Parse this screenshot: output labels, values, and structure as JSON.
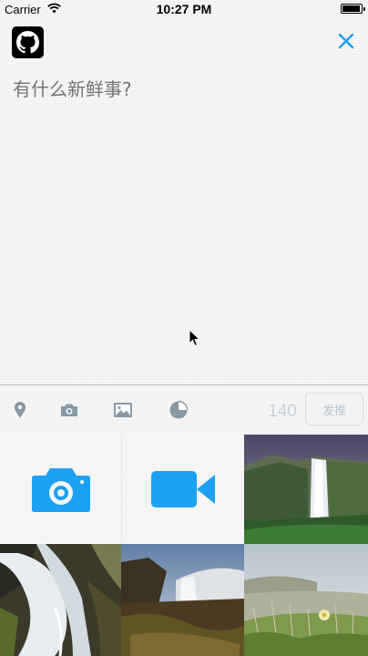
{
  "status_bar": {
    "carrier": "Carrier",
    "time": "10:27 PM",
    "battery_level": 0.95
  },
  "header": {
    "avatar_icon": "github-octocat-icon",
    "close_icon": "close-icon",
    "accent_color": "#1da1f2"
  },
  "composer": {
    "placeholder": "有什么新鲜事?",
    "text": ""
  },
  "toolbar": {
    "icons": [
      "location-pin-icon",
      "camera-icon",
      "image-icon",
      "poll-icon"
    ],
    "char_count": "140",
    "send_label": "发推"
  },
  "media_grid": {
    "buttons": [
      {
        "icon": "camera-icon"
      },
      {
        "icon": "video-camera-icon"
      }
    ],
    "photos": [
      "waterfall-photo",
      "river-rapids-photo",
      "waterfall-landscape-photo",
      "coastal-plants-photo"
    ]
  }
}
